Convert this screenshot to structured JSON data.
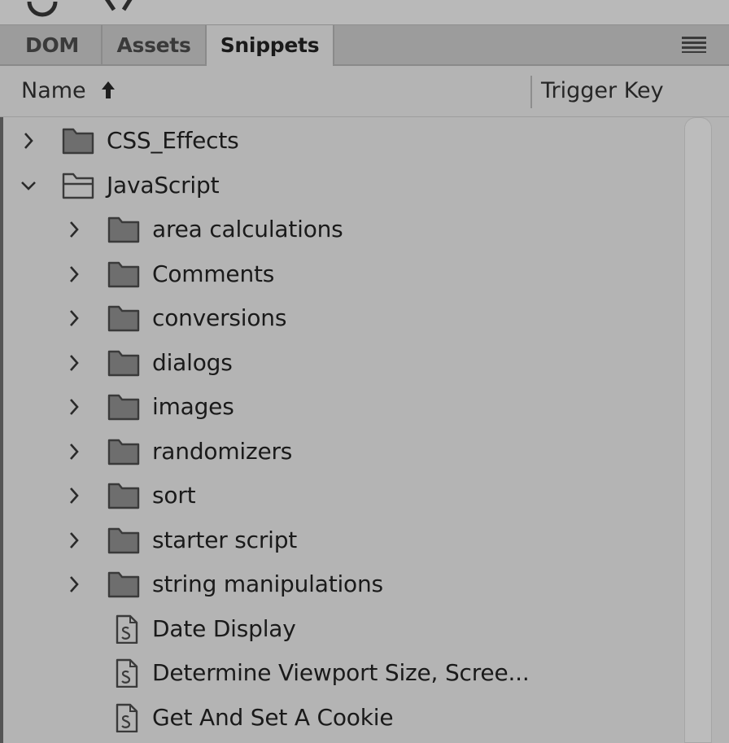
{
  "tabs": [
    {
      "label": "DOM",
      "active": false
    },
    {
      "label": "Assets",
      "active": false
    },
    {
      "label": "Snippets",
      "active": true
    }
  ],
  "header": {
    "name_label": "Name",
    "trigger_label": "Trigger Key",
    "sort_icon": "arrow-up-icon",
    "menu_icon": "hamburger-menu-icon"
  },
  "tree": [
    {
      "label": "CSS_Effects",
      "type": "folder",
      "expanded": false,
      "level": 0
    },
    {
      "label": "JavaScript",
      "type": "folder",
      "expanded": true,
      "level": 0
    },
    {
      "label": "area calculations",
      "type": "folder",
      "expanded": false,
      "level": 1
    },
    {
      "label": "Comments",
      "type": "folder",
      "expanded": false,
      "level": 1
    },
    {
      "label": "conversions",
      "type": "folder",
      "expanded": false,
      "level": 1
    },
    {
      "label": "dialogs",
      "type": "folder",
      "expanded": false,
      "level": 1
    },
    {
      "label": "images",
      "type": "folder",
      "expanded": false,
      "level": 1
    },
    {
      "label": "randomizers",
      "type": "folder",
      "expanded": false,
      "level": 1
    },
    {
      "label": "sort",
      "type": "folder",
      "expanded": false,
      "level": 1
    },
    {
      "label": "starter script",
      "type": "folder",
      "expanded": false,
      "level": 1
    },
    {
      "label": "string manipulations",
      "type": "folder",
      "expanded": false,
      "level": 1
    },
    {
      "label": "Date Display",
      "type": "snippet",
      "level": 1
    },
    {
      "label": "Determine Viewport Size, Scree...",
      "type": "snippet",
      "level": 1
    },
    {
      "label": "Get And Set A Cookie",
      "type": "snippet",
      "level": 1
    }
  ],
  "colors": {
    "panel_bg": "#b4b4b4",
    "tabbar_bg": "#9c9c9c",
    "text": "#1a1a1a",
    "icon_fill": "#6e6e6e"
  }
}
